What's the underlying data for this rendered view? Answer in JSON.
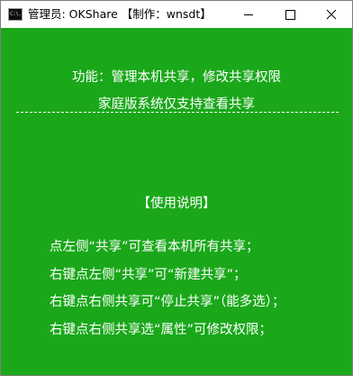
{
  "window": {
    "title": "管理员:  OKShare  【制作：wnsdt】",
    "icon_name": "cmd-icon",
    "icon_text": "C:\\."
  },
  "controls": {
    "minimize": "minimize-icon",
    "maximize": "maximize-icon",
    "close": "close-icon"
  },
  "header": {
    "function_line": "功能：管理本机共享，修改共享权限",
    "support_line": "家庭版系统仅支持查看共享"
  },
  "usage": {
    "title": "【使用说明】",
    "lines": [
      "点左侧“共享”可查看本机所有共享；",
      "右键点左侧“共享”可“新建共享”；",
      "右键点右侧共享可“停止共享”（能多选）；",
      "右键点右侧共享选“属性”可修改权限；"
    ]
  },
  "colors": {
    "background": "#1aa81a",
    "text": "#ffffff",
    "titlebar": "#ffffff"
  }
}
